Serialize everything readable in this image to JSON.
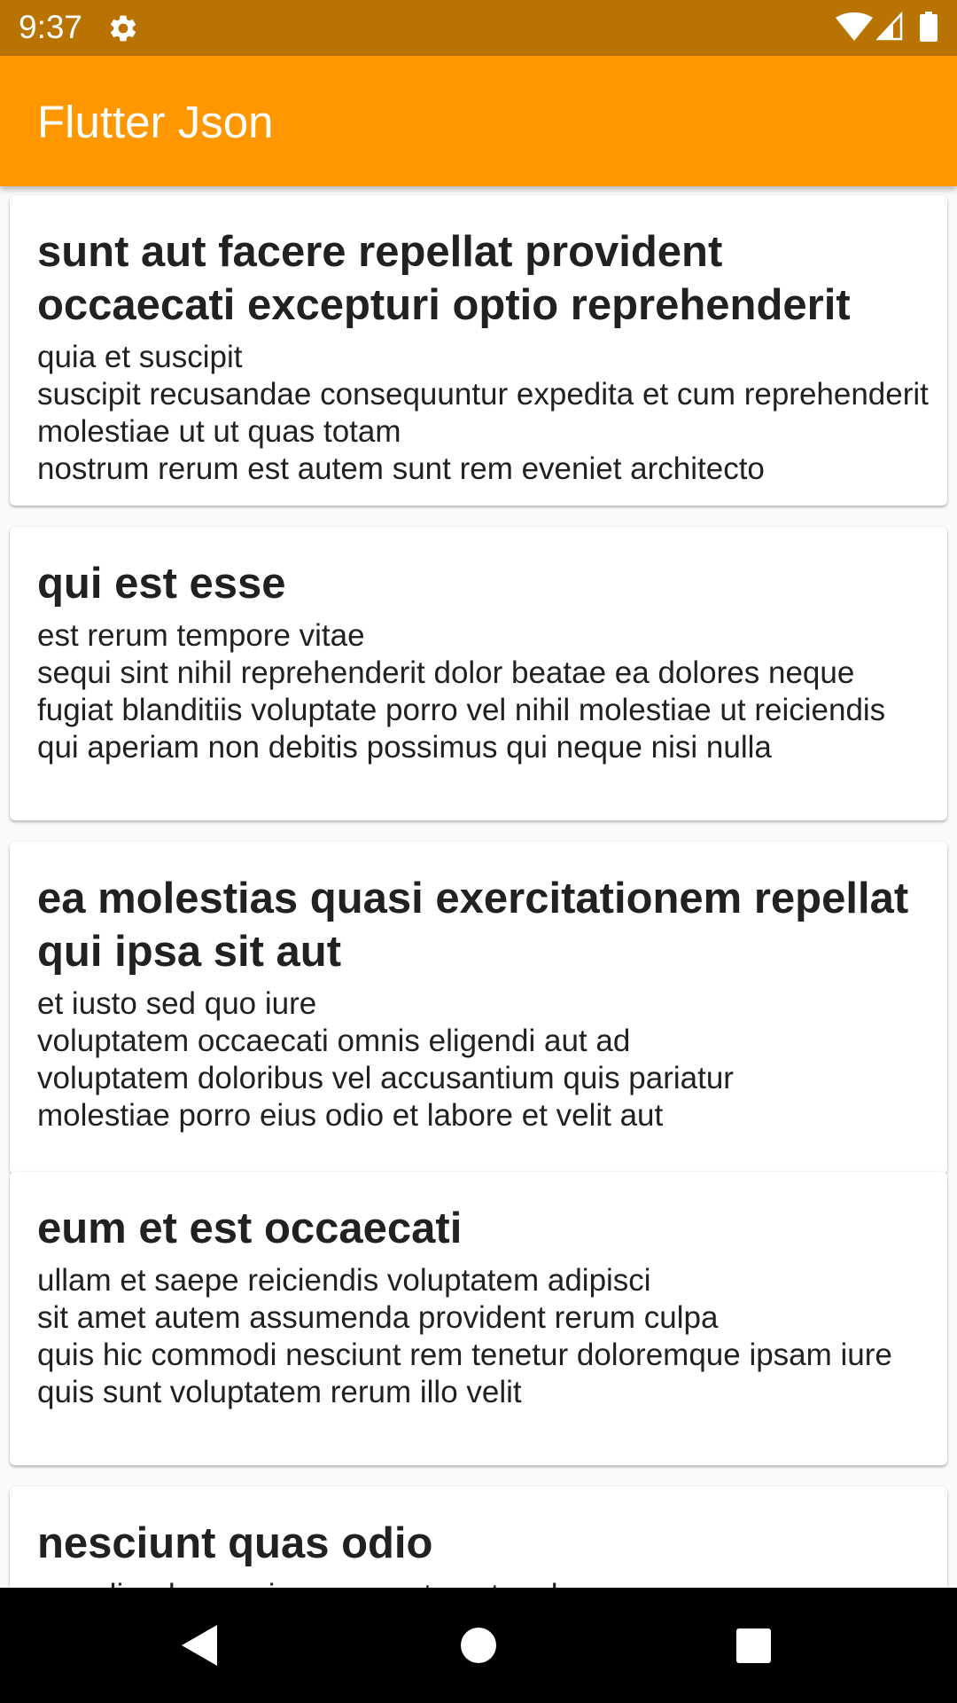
{
  "status_bar": {
    "time": "9:37",
    "icons": [
      "gear-icon",
      "wifi-icon",
      "signal-icon",
      "battery-icon"
    ]
  },
  "app_bar": {
    "title": "Flutter Json",
    "color": "#ff9800",
    "status_color": "#b97300"
  },
  "posts": [
    {
      "title": "sunt aut facere repellat provident occaecati excepturi optio reprehenderit",
      "body": "quia et suscipit\nsuscipit recusandae consequuntur expedita et cum reprehenderit molestiae ut ut quas totam\nnostrum rerum est autem sunt rem eveniet architecto"
    },
    {
      "title": "qui est esse",
      "body": "est rerum tempore vitae\nsequi sint nihil reprehenderit dolor beatae ea dolores neque fugiat blanditiis voluptate porro vel nihil molestiae ut reiciendis\nqui aperiam non debitis possimus qui neque nisi nulla"
    },
    {
      "title": "ea molestias quasi exercitationem repellat qui ipsa sit aut",
      "body": "et iusto sed quo iure\nvoluptatem occaecati omnis eligendi aut ad\nvoluptatem doloribus vel accusantium quis pariatur\nmolestiae porro eius odio et labore et velit aut"
    },
    {
      "title": "eum et est occaecati",
      "body": "ullam et saepe reiciendis voluptatem adipisci\nsit amet autem assumenda provident rerum culpa\nquis hic commodi nesciunt rem tenetur doloremque ipsam iure\nquis sunt voluptatem rerum illo velit"
    },
    {
      "title": "nesciunt quas odio",
      "body": "repudiandae veniam quaerat sunt sed"
    }
  ],
  "nav_bar": {
    "icons": [
      "back-icon",
      "home-icon",
      "recents-icon"
    ]
  }
}
